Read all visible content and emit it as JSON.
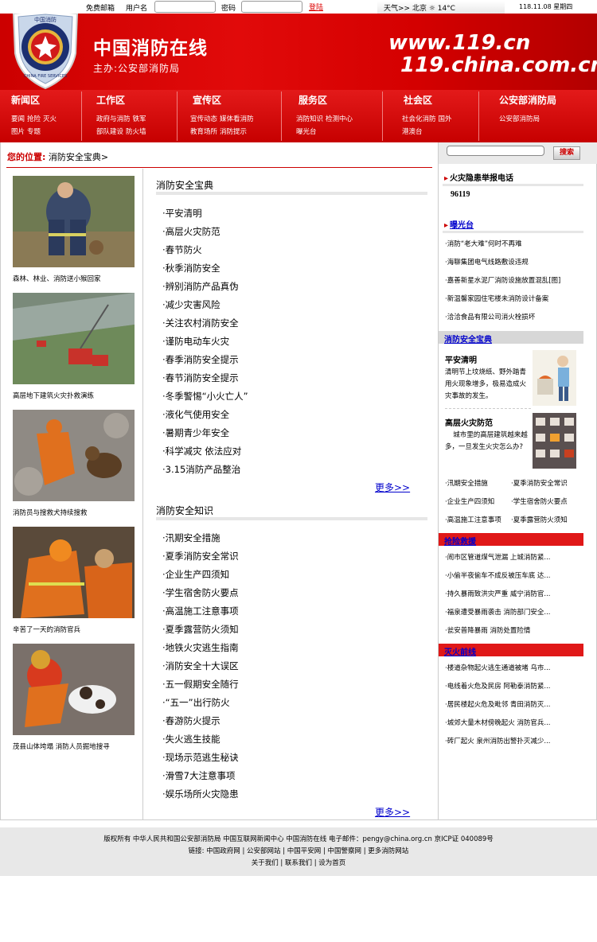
{
  "topbar": {
    "mail": "免费邮箱",
    "username_label": "用户名",
    "password_label": "密码",
    "login": "登陆",
    "weather": "天气>> 北京 ☼ 14°C",
    "date": "118.11.08 星期四"
  },
  "banner": {
    "site_name": "中国消防在线",
    "sponsor": "主办:公安部消防局",
    "url1": "www.119.cn",
    "url2": "119.china.com.cn",
    "emblem_text": "中国消防",
    "emblem_text2": "CHINA FIRE SERVICES"
  },
  "nav": [
    {
      "title": "新闻区",
      "links": [
        "要闻",
        "抢险",
        "灭火",
        "图片",
        "专题"
      ]
    },
    {
      "title": "工作区",
      "links": [
        "政府与消防",
        "铁军",
        "部队建设",
        "防火墙"
      ]
    },
    {
      "title": "宣传区",
      "links": [
        "宣传动态",
        "媒体看消防",
        "教育场所",
        "消防提示"
      ]
    },
    {
      "title": "服务区",
      "links": [
        "消防知识",
        "检测中心",
        "曝光台"
      ]
    },
    {
      "title": "社会区",
      "links": [
        "社会化消防",
        "国外",
        "港澳台"
      ]
    },
    {
      "title": "公安部消防局",
      "links": [
        "公安部消防局"
      ]
    }
  ],
  "breadcrumb": {
    "label": "您的位置:",
    "path": "消防安全宝典>"
  },
  "photos": [
    {
      "caption": "森林、林业、消防送小猴回家"
    },
    {
      "caption": "高层地下建筑火灾扑救演练"
    },
    {
      "caption": "消防员与搜救犬持续搜救"
    },
    {
      "caption": "辛苦了一天的消防官兵"
    },
    {
      "caption": "茂县山体垮塌 消防人员掘地搜寻"
    }
  ],
  "section1": {
    "title": "消防安全宝典",
    "items": [
      "·平安清明",
      "·高层火灾防范",
      "·春节防火",
      "·秋季消防安全",
      "·辨别消防产品真伪",
      "·减少灾害风险",
      "·关注农村消防安全",
      "·谨防电动车火灾",
      "·春季消防安全提示",
      "·春节消防安全提示",
      "·冬季警惕“小火亡人”",
      "·液化气使用安全",
      "·暑期青少年安全",
      "·科学减灾 依法应对",
      "·3.15消防产品整治"
    ],
    "more": "更多>>"
  },
  "section2": {
    "title": "消防安全知识",
    "items": [
      "·汛期安全措施",
      "·夏季消防安全常识",
      "·企业生产四须知",
      "·学生宿舍防火要点",
      "·高温施工注意事项",
      "·夏季露营防火须知",
      "·地铁火灾逃生指南",
      "·消防安全十大误区",
      "·五一假期安全随行",
      "·“五一”出行防火",
      "·春游防火提示",
      "·失火逃生技能",
      "·现场示范逃生秘诀",
      "·滑雪7大注意事项",
      "·娱乐场所火灾隐患"
    ],
    "more": "更多>>"
  },
  "right": {
    "search_button": "搜索",
    "hotline_title": "火灾隐患举报电话",
    "hotline_number": "96119",
    "exposure_title": "曝光台",
    "exposure_items": [
      "·消防“老大难”何时不再难",
      "·海聊集团电气线路敷设违规",
      "·嘉善新星水泥厂消防设施放置混乱[图]",
      "·新温馨家园住宅楼未消防设计备案",
      "·洽洽食品有限公司消火栓损坏"
    ],
    "guide_title": "消防安全宝典",
    "feature1_title": "平安清明",
    "feature1_desc": "清明节上坟烧纸、野外踏青用火现象增多，极易造成火灾事故的发生。",
    "feature2_title": "高层火灾防范",
    "feature2_desc": "城市里的高层建筑越来越多，一旦发生火灾怎么办?",
    "guide_links": [
      [
        "·汛期安全措施",
        "·夏季消防安全常识"
      ],
      [
        "·企业生产四须知",
        "·学生宿舍防火要点"
      ],
      [
        "·高温施工注意事项",
        "·夏季露营防火须知"
      ]
    ],
    "rescue_title": "抢险救援",
    "rescue_items": [
      "·闹市区管道煤气泄漏 上城消防紧...",
      "·小偷半夜偷车不成反被压车底 达...",
      "·持久暴雨致洪灾严重 威宁消防官...",
      "·福泉遭受暴雨袭击 消防部门安全...",
      "·瓮安普降暴雨 消防处置险情"
    ],
    "fire_title": "灭火前线",
    "fire_items": [
      "·楼道杂物起火逃生通道被堵 乌市...",
      "·电线着火危及民房 阿勒泰消防紧...",
      "·居民楼起火危及毗邻 青田消防灭...",
      "·城郊大量木材傍晚起火 消防官兵...",
      "·砖厂起火 泉州消防出警扑灭减少..."
    ]
  },
  "footer": {
    "line1": "版权所有 中华人民共和国公安部消防局 中国互联网新闻中心 中国消防在线 电子邮件：pengy@china.org.cn 京ICP证 040089号",
    "line2": "链接: 中国政府网 | 公安部网站 | 中国平安网 | 中国警察网 | 更多消防网站",
    "line3": "关于我们 | 联系我们 | 设为首页"
  },
  "colors": {
    "brand_red": "#d40000",
    "link_blue": "#0000cc"
  }
}
